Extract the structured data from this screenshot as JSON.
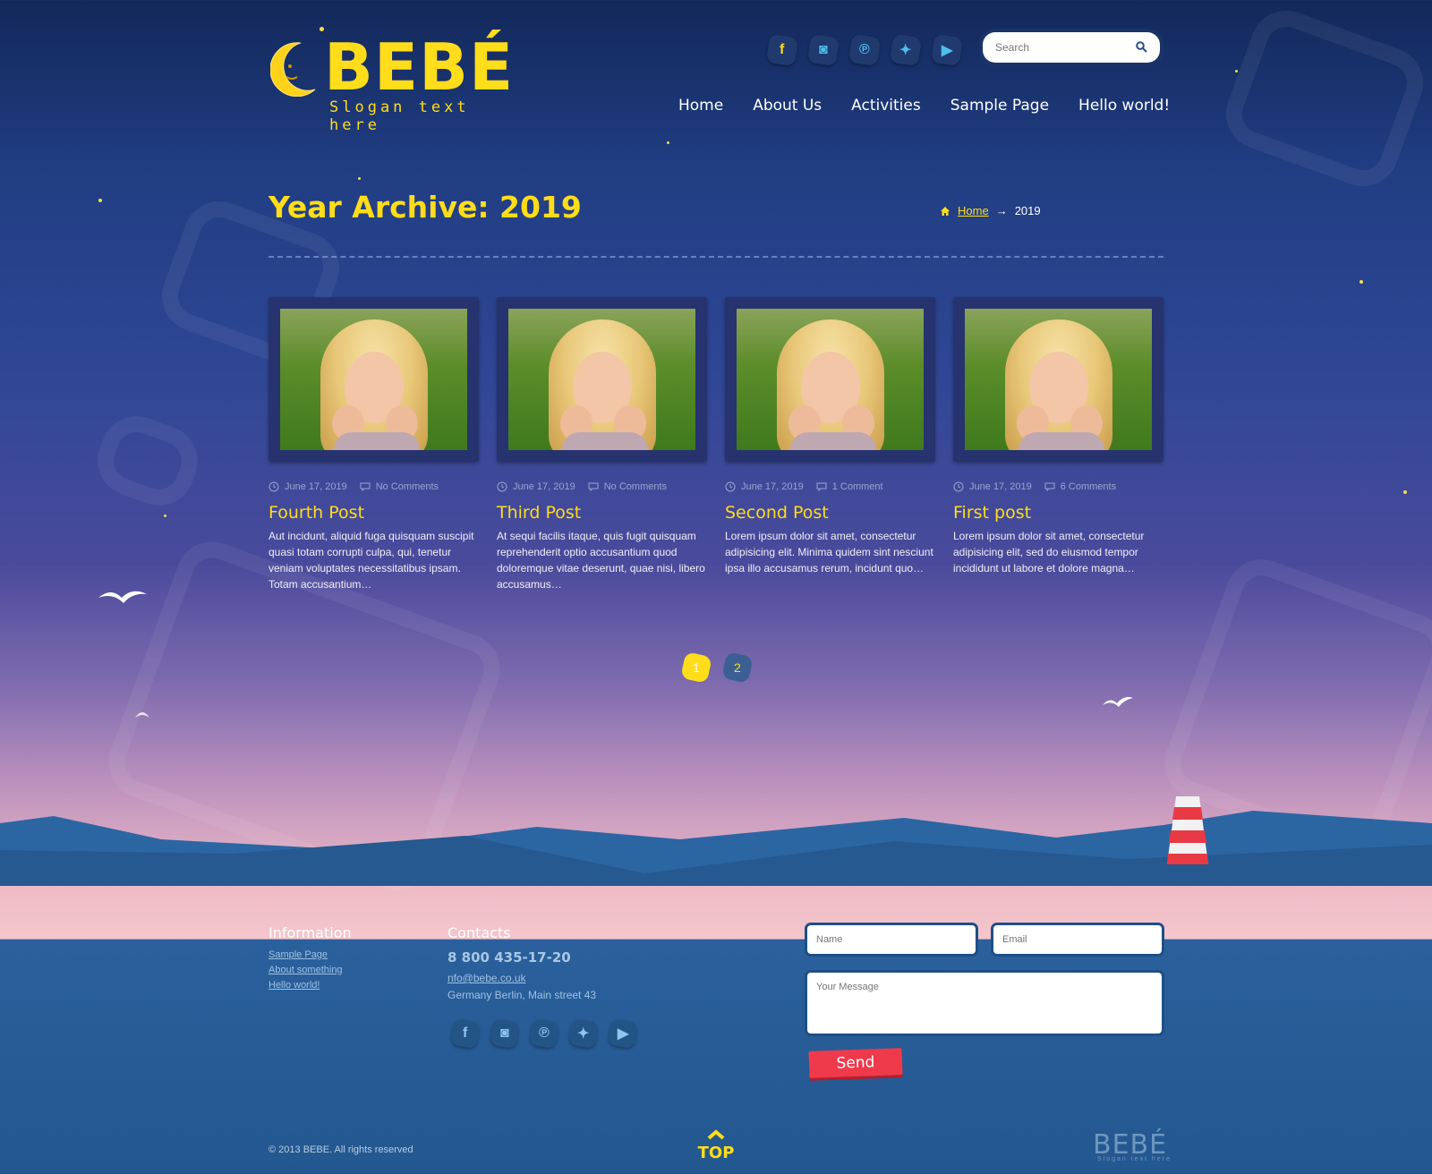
{
  "header": {
    "logo": "BEBÉ",
    "slogan": "Slogan text here",
    "search_placeholder": "Search",
    "social": [
      {
        "icon": "facebook-icon",
        "glyph": "f"
      },
      {
        "icon": "instagram-icon",
        "glyph": "◙"
      },
      {
        "icon": "pinterest-icon",
        "glyph": "℗"
      },
      {
        "icon": "twitter-icon",
        "glyph": "✦"
      },
      {
        "icon": "youtube-icon",
        "glyph": "▶"
      }
    ],
    "nav": [
      "Home",
      "About Us",
      "Activities",
      "Sample Page",
      "Hello world!"
    ]
  },
  "page": {
    "title": "Year Archive: 2019",
    "breadcrumb": {
      "home": "Home",
      "arrow": "→",
      "current": "2019"
    }
  },
  "posts": [
    {
      "date": "June 17, 2019",
      "comments": "No Comments",
      "title": "Fourth Post",
      "excerpt": "Aut incidunt, aliquid fuga quisquam suscipit quasi totam corrupti culpa, qui, tenetur veniam voluptates necessitatibus ipsam. Totam accusantium…"
    },
    {
      "date": "June 17, 2019",
      "comments": "No Comments",
      "title": "Third Post",
      "excerpt": "At sequi facilis itaque, quis fugit quisquam reprehenderit optio accusantium quod doloremque vitae deserunt, quae nisi, libero accusamus…"
    },
    {
      "date": "June 17, 2019",
      "comments": "1 Comment",
      "title": "Second Post",
      "excerpt": "Lorem ipsum dolor sit amet, consectetur adipisicing elit. Minima quidem sint nesciunt ipsa illo accusamus rerum, incidunt quo…"
    },
    {
      "date": "June 17, 2019",
      "comments": "6 Comments",
      "title": "First post",
      "excerpt": "Lorem ipsum dolor sit amet, consectetur adipisicing elit, sed do eiusmod tempor incididunt ut labore et dolore magna…"
    }
  ],
  "pagination": {
    "pages": [
      "1",
      "2"
    ],
    "active": "1"
  },
  "footer": {
    "information": {
      "heading": "Information",
      "links": [
        "Sample Page",
        "About something",
        "Hello world!"
      ]
    },
    "contacts": {
      "heading": "Contacts",
      "phone": "8 800 435-17-20",
      "email": "nfo@bebe.co.uk",
      "address": "Germany Berlin, Main street 43"
    },
    "form": {
      "name_placeholder": "Name",
      "email_placeholder": "Email",
      "message_placeholder": "Your Message",
      "send_label": "Send"
    },
    "copyright": "© 2013 BEBE. All rights reserved",
    "top_label": "TOP",
    "logo": "BEBÉ",
    "slogan": "Slogan text here"
  },
  "colors": {
    "accent_yellow": "#ffdd1a",
    "send_red": "#ef3a4c",
    "sky_top": "#13285a",
    "sea": "#23578f"
  }
}
